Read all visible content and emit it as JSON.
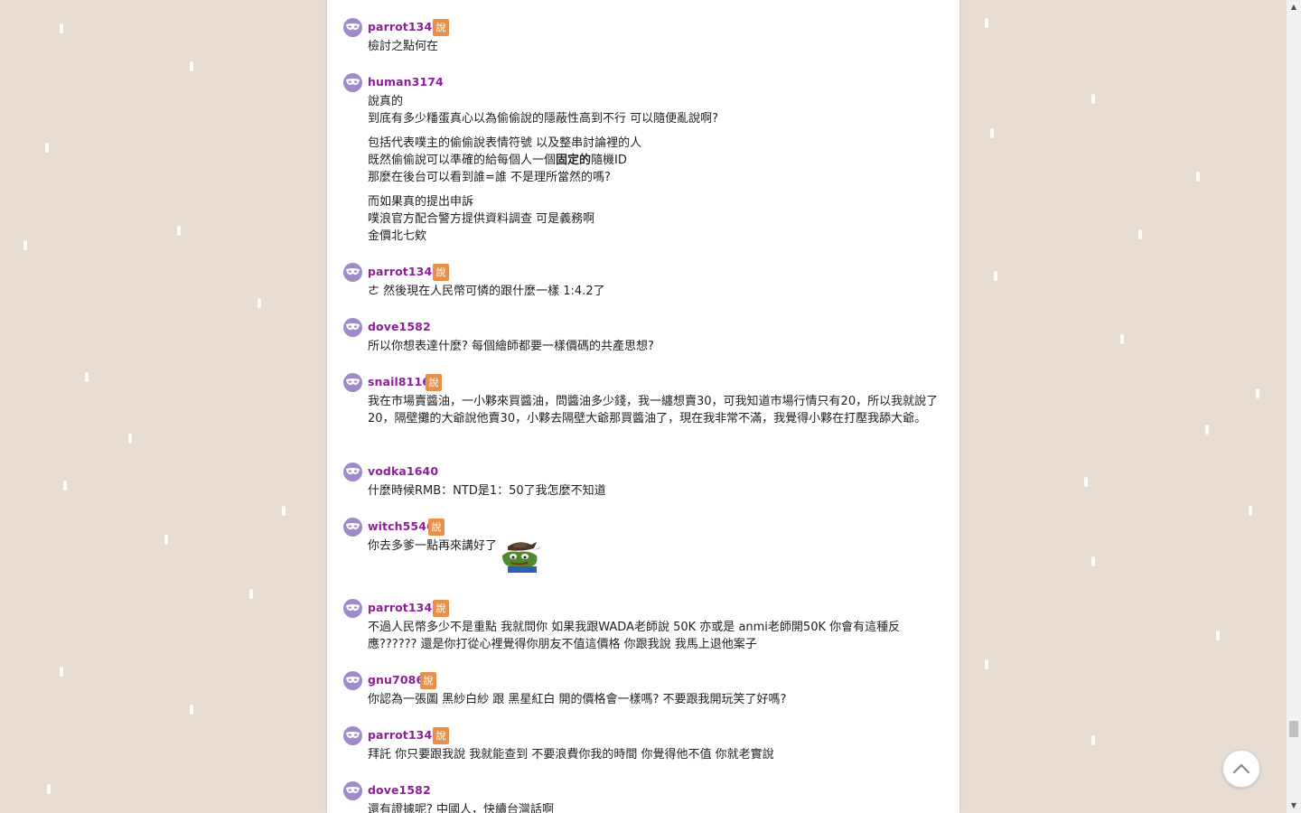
{
  "comments": [
    {
      "user": "parrot1344",
      "badge": "說",
      "lines": [
        "檢討之點何在"
      ]
    },
    {
      "user": "human3174",
      "badge": "",
      "lines": [
        "說真的",
        "到底有多少䊩蛋真心以為偷偷說的隱蔽性高到不行 可以隨便亂說啊?",
        "包括代表噗主的偷偷說表情符號 以及整串討論裡的人",
        "既然偷偷說可以準確的給每個人一個",
        "固定的",
        "隨機ID",
        "那麼在後台可以看到誰=誰 不是理所當然的嗎?",
        "而如果真的提出申訴",
        "噗浪官方配合警方提供資料調查 可是義務啊",
        "金價北七欸"
      ]
    },
    {
      "user": "parrot1344",
      "badge": "說",
      "lines": [
        "ㄜ 然後現在人民幣可憐的跟什麼一樣 1:4.2了"
      ]
    },
    {
      "user": "dove1582",
      "badge": "",
      "lines": [
        "所以你想表達什麼? 每個繪師都要一樣價碼的共產思想?"
      ]
    },
    {
      "user": "snail8116",
      "badge": "說",
      "lines": [
        "我在市場賣醬油，一小夥來買醬油，問醬油多少錢，我一纏想賣30，可我知道市場行情只有20，所以我就說了20，隔壁攤的大爺說他賣30，小夥去隔壁大爺那買醬油了，現在我非常不滿，我覺得小夥在打壓我舔大爺。"
      ]
    },
    {
      "user": "vodka1640",
      "badge": "",
      "lines": [
        "什麼時候RMB：NTD是1：50了我怎麼不知道"
      ]
    },
    {
      "user": "witch5546",
      "badge": "說",
      "lines": [
        "你去多爹一點再來講好了"
      ]
    },
    {
      "user": "parrot1344",
      "badge": "說",
      "lines": [
        "不過人民幣多少不是重點 我就問你 如果我跟WADA老師說 50K 亦或是 anmi老師開50K 你會有這種反應?????? 還是你打從心裡覺得你朋友不值這價格 你跟我說 我馬上退他案子"
      ]
    },
    {
      "user": "gnu7086",
      "badge": "說",
      "lines": [
        "你認為一張圖 黑紗白紗 跟 黑星紅白 開的價格會一樣嗎? 不要跟我開玩笑了好嗎?"
      ]
    },
    {
      "user": "parrot1344",
      "badge": "說",
      "lines": [
        "拜託 你只要跟我說 我就能查到 不要浪費你我的時間 你覺得他不值 你就老實說"
      ]
    },
    {
      "user": "dove1582",
      "badge": "",
      "lines": [
        "還有證據呢? 中國人，快續台灣話啊"
      ]
    }
  ],
  "colors": {
    "username": "#8d1f98",
    "badge": "#e6904a",
    "avatar": "#9e8bc7",
    "background": "#e8ddd2"
  },
  "icons": {
    "avatar": "mask-icon",
    "sticker": "pepe-cowboy-sticker",
    "back_to_top": "chevron-up-icon"
  }
}
